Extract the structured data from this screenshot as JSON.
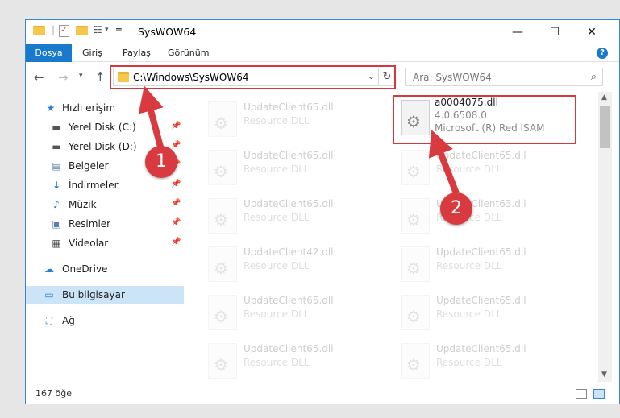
{
  "window": {
    "title": "SysWOW64",
    "minimize_glyph": "—",
    "maximize_glyph": "☐",
    "close_glyph": "✕"
  },
  "ribbon": {
    "tabs": [
      {
        "label": "Dosya"
      },
      {
        "label": "Giriş"
      },
      {
        "label": "Paylaş"
      },
      {
        "label": "Görünüm"
      }
    ],
    "help_glyph": "?"
  },
  "address_bar": {
    "path": "C:\\Windows\\SysWOW64",
    "refresh_glyph": "↻",
    "dropdown_glyph": "⌄"
  },
  "search": {
    "placeholder": "Ara: SysWOW64",
    "icon": "search-icon"
  },
  "sidebar": {
    "items": [
      {
        "label": "Hızlı erişim",
        "icon": "star-icon",
        "pinned": false
      },
      {
        "label": "Yerel Disk (C:)",
        "icon": "drive-icon",
        "pinned": true
      },
      {
        "label": "Yerel Disk (D:)",
        "icon": "drive-icon",
        "pinned": true
      },
      {
        "label": "Belgeler",
        "icon": "documents-icon",
        "pinned": true
      },
      {
        "label": "İndirmeler",
        "icon": "download-icon",
        "pinned": true
      },
      {
        "label": "Müzik",
        "icon": "music-icon",
        "pinned": true
      },
      {
        "label": "Resimler",
        "icon": "pictures-icon",
        "pinned": true
      },
      {
        "label": "Videolar",
        "icon": "video-icon",
        "pinned": true
      },
      {
        "label": "OneDrive",
        "icon": "cloud-icon",
        "pinned": false
      },
      {
        "label": "Bu bilgisayar",
        "icon": "computer-icon",
        "pinned": false
      },
      {
        "label": "Ağ",
        "icon": "network-icon",
        "pinned": false
      }
    ]
  },
  "files": {
    "highlighted": {
      "name": "a0004075.dll",
      "version": "4.0.6508.0",
      "company": "Microsoft (R) Red ISAM"
    },
    "left_column": [
      {
        "name": "UpdateClient65.dll",
        "desc": "Resource DLL"
      },
      {
        "name": "UpdateClient65.dll",
        "desc": "Resource DLL"
      },
      {
        "name": "UpdateClient65.dll",
        "desc": "Resource DLL"
      },
      {
        "name": "UpdateClient42.dll",
        "desc": "Resource DLL"
      },
      {
        "name": "UpdateClient65.dll",
        "desc": "Resource DLL"
      },
      {
        "name": "UpdateClient65.dll",
        "desc": "Resource DLL"
      }
    ],
    "right_column": [
      {
        "name": "UpdateClient65.dll",
        "desc": "Resource DLL"
      },
      {
        "name": "UpdateClient63.dll",
        "desc": "Resource DLL"
      },
      {
        "name": "UpdateClient65.dll",
        "desc": "Resource DLL"
      },
      {
        "name": "UpdateClient65.dll",
        "desc": "Resource DLL"
      },
      {
        "name": "UpdateClient65.dll",
        "desc": "Resource DLL"
      }
    ]
  },
  "status": {
    "item_count": "167 öğe"
  },
  "annotations": {
    "step1": "1",
    "step2": "2",
    "accent_color": "#d83a3f"
  },
  "colors": {
    "ribbon_active": "#1979ca",
    "selection": "#cce4f7",
    "highlight_box": "#d6383f"
  }
}
